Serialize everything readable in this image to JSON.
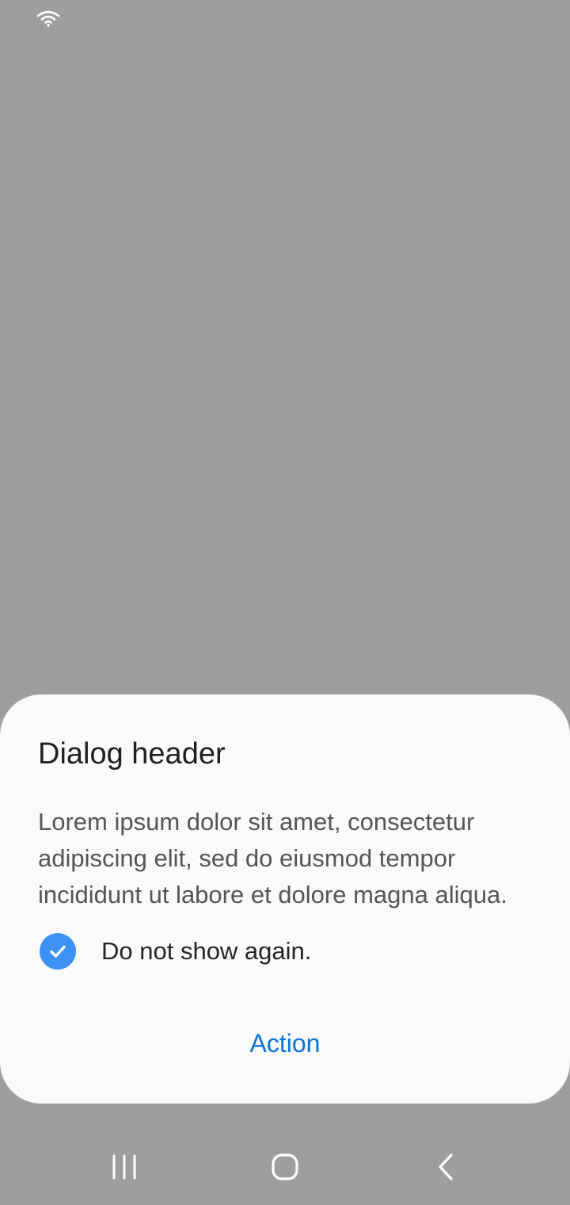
{
  "status_bar": {
    "wifi_icon": "wifi-icon"
  },
  "dialog": {
    "title": "Dialog header",
    "body": "Lorem ipsum dolor sit amet, consectetur adipiscing elit, sed do eiusmod tempor incididunt ut labore et dolore magna aliqua.",
    "checkbox": {
      "label": "Do not show again.",
      "checked": true,
      "icon": "check-circle-icon"
    },
    "action_label": "Action"
  },
  "nav_bar": {
    "items": [
      {
        "icon": "recents-icon"
      },
      {
        "icon": "home-icon"
      },
      {
        "icon": "back-icon"
      }
    ]
  },
  "colors": {
    "scrim": "#9e9e9e",
    "dialog_bg": "#fafafa",
    "accent": "#0a72d8",
    "checkbox": "#3e91f5"
  }
}
